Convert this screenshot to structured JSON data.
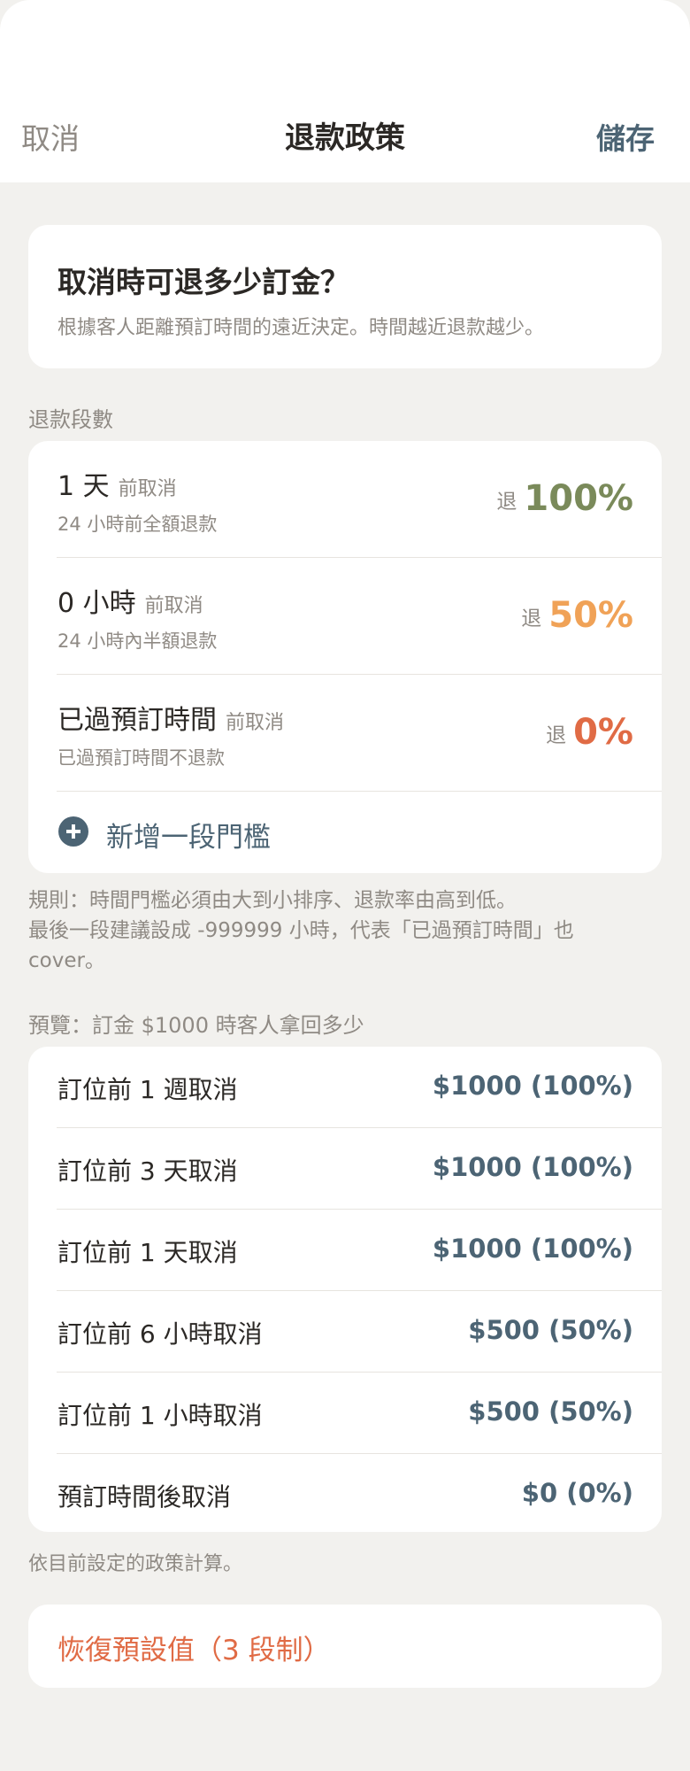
{
  "header": {
    "cancel_label": "取消",
    "title": "退款政策",
    "save_label": "儲存"
  },
  "intro": {
    "title": "取消時可退多少訂金？",
    "subtitle": "根據客人距離預訂時間的遠近決定。時間越近退款越少。"
  },
  "tiers_section": {
    "label": "退款段數",
    "refund_prefix": "退",
    "cancel_suffix": "前取消",
    "tiers": [
      {
        "threshold": "1 天",
        "description": "24 小時前全額退款",
        "refund": "100%",
        "color": "#7a8a5a"
      },
      {
        "threshold": "0 小時",
        "description": "24 小時內半額退款",
        "refund": "50%",
        "color": "#f0a257"
      },
      {
        "threshold": "已過預訂時間",
        "description": "已過預訂時間不退款",
        "refund": "0%",
        "color": "#e06b45"
      }
    ],
    "add_label": "新增一段門檻"
  },
  "rule": {
    "line1": "規則：時間門檻必須由大到小排序、退款率由高到低。",
    "line2": "最後一段建議設成 -999999 小時，代表「已過預訂時間」也",
    "line3": "cover。"
  },
  "preview": {
    "label": "預覽：訂金 $1000 時客人拿回多少",
    "rows": [
      {
        "label": "訂位前 1 週取消",
        "value": "$1000 (100%)"
      },
      {
        "label": "訂位前 3 天取消",
        "value": "$1000 (100%)"
      },
      {
        "label": "訂位前 1 天取消",
        "value": "$1000 (100%)"
      },
      {
        "label": "訂位前 6 小時取消",
        "value": "$500 (50%)"
      },
      {
        "label": "訂位前 1 小時取消",
        "value": "$500 (50%)"
      },
      {
        "label": "預訂時間後取消",
        "value": "$0 (0%)"
      }
    ],
    "note": "依目前設定的政策計算。"
  },
  "reset": {
    "label": "恢復預設值（3 段制）"
  },
  "colors": {
    "accent": "#4c6474",
    "destructive": "#e06b45",
    "muted": "#8f8a84",
    "background": "#f2f1ee"
  }
}
